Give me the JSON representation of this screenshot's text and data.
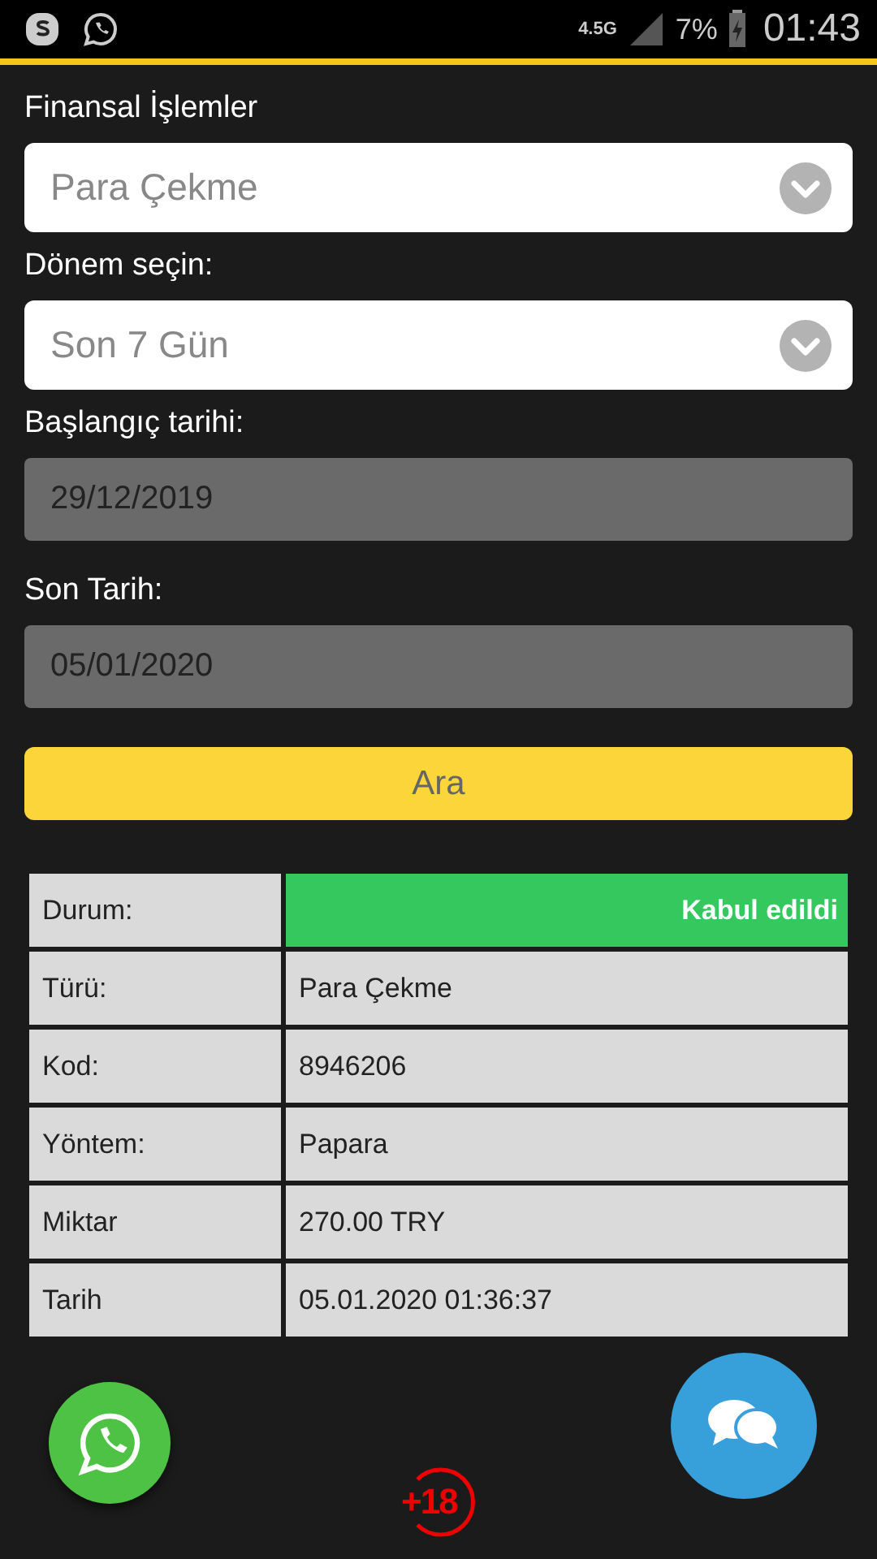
{
  "status_bar": {
    "network": "4.5G",
    "battery": "7%",
    "time": "01:43"
  },
  "form": [
    {
      "label": "Finansal İşlemler",
      "kind": "select",
      "value": "Para Çekme"
    },
    {
      "label": "Dönem seçin:",
      "kind": "select",
      "value": "Son 7 Gün"
    },
    {
      "label": "Başlangıç tarihi:",
      "kind": "date",
      "value": "29/12/2019"
    },
    {
      "label": "Son Tarih:",
      "kind": "date",
      "value": "05/01/2020"
    }
  ],
  "search_button": "Ara",
  "details": [
    {
      "label": "Durum:",
      "value": "Kabul edildi",
      "kind": "status"
    },
    {
      "label": "Türü:",
      "value": "Para Çekme",
      "kind": "text"
    },
    {
      "label": "Kod:",
      "value": "8946206",
      "kind": "text"
    },
    {
      "label": "Yöntem:",
      "value": "Papara",
      "kind": "text"
    },
    {
      "label": "Miktar",
      "value": "270.00 TRY",
      "kind": "text"
    },
    {
      "label": "Tarih",
      "value": "05.01.2020 01:36:37",
      "kind": "text"
    }
  ],
  "age_badge": "+18"
}
